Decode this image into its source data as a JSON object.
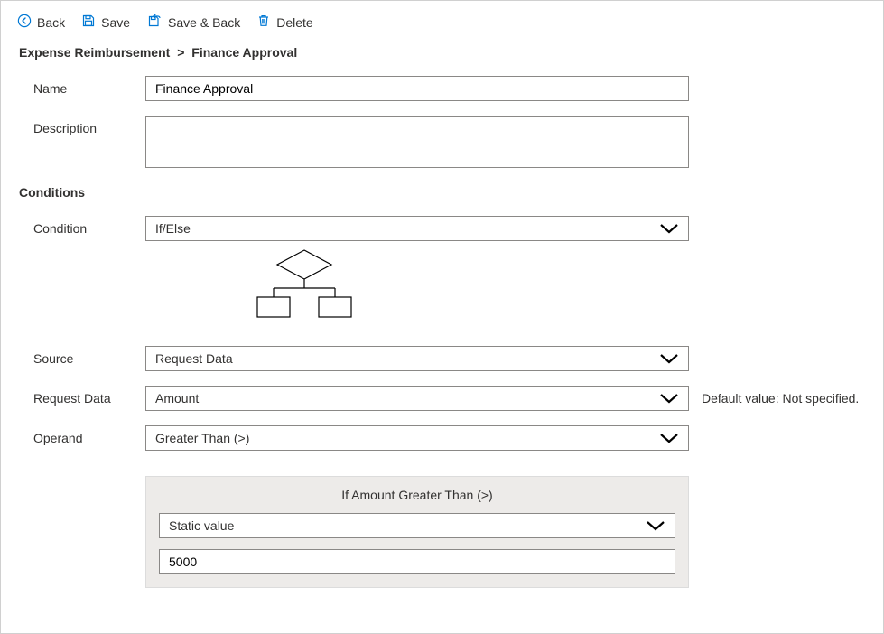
{
  "toolbar": {
    "back": "Back",
    "save": "Save",
    "save_and_back": "Save & Back",
    "delete": "Delete"
  },
  "breadcrumb": {
    "parent": "Expense Reimbursement",
    "sep": ">",
    "current": "Finance Approval"
  },
  "fields": {
    "name_label": "Name",
    "name_value": "Finance Approval",
    "description_label": "Description",
    "description_value": ""
  },
  "conditions": {
    "heading": "Conditions",
    "condition_label": "Condition",
    "condition_value": "If/Else",
    "source_label": "Source",
    "source_value": "Request Data",
    "request_data_label": "Request Data",
    "request_data_value": "Amount",
    "request_data_note": "Default value: Not specified.",
    "operand_label": "Operand",
    "operand_value": "Greater Than (>)"
  },
  "subpanel": {
    "title": "If Amount Greater Than (>)",
    "value_type": "Static value",
    "value": "5000"
  }
}
